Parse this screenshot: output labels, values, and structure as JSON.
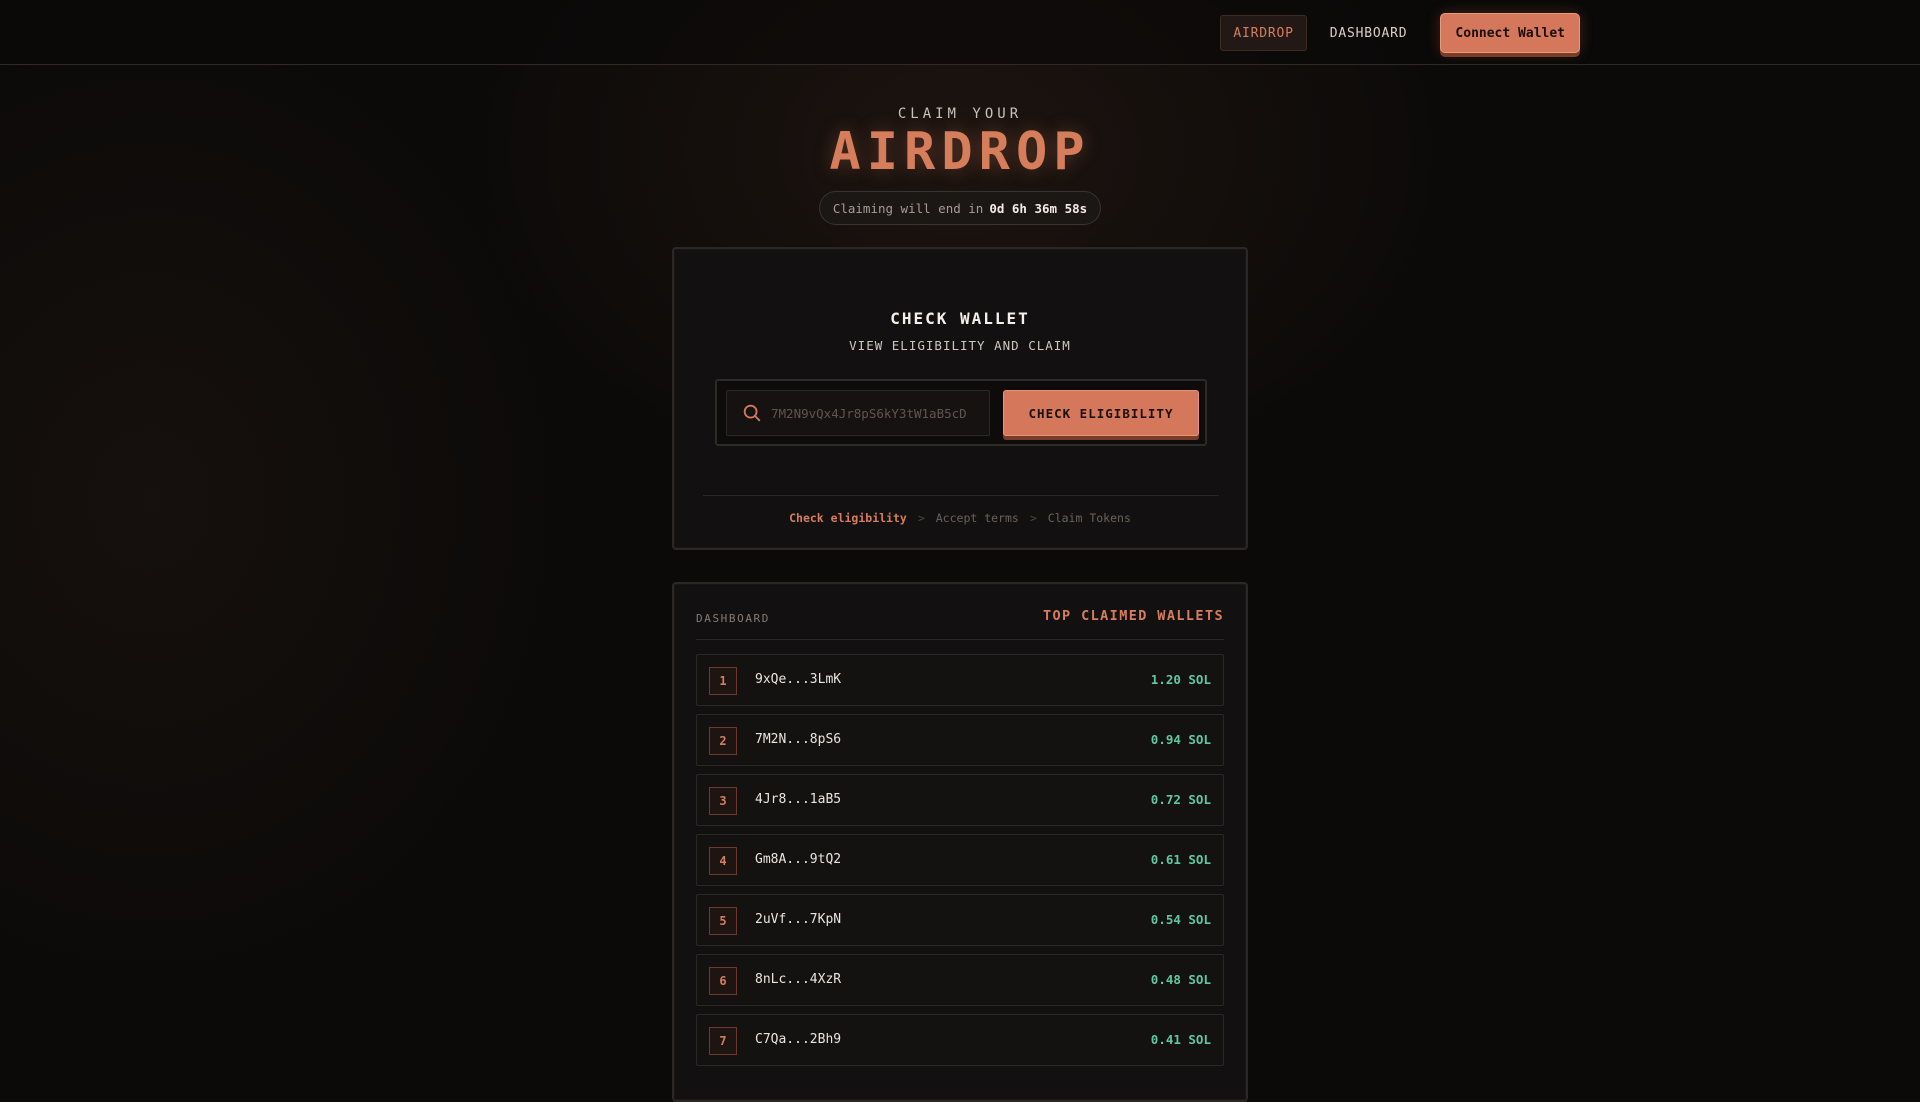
{
  "nav": {
    "items": [
      {
        "label": "AIRDROP",
        "active": true
      },
      {
        "label": "DASHBOARD",
        "active": false
      }
    ],
    "connect_label": "Connect Wallet"
  },
  "hero": {
    "kicker": "CLAIM YOUR",
    "title": "AIRDROP",
    "countdown_prefix": "Claiming will end in",
    "countdown_value": "0d 6h 36m 58s"
  },
  "check": {
    "title": "CHECK WALLET",
    "subtitle": "VIEW ELIGIBILITY AND CLAIM",
    "search_placeholder": "7M2N9vQx4Jr8pS6kY3tW1aB5cD",
    "button_label": "CHECK ELIGIBILITY",
    "steps": [
      {
        "label": "Check eligibility",
        "current": true
      },
      {
        "label": "Accept terms",
        "current": false
      },
      {
        "label": "Claim Tokens",
        "current": false
      }
    ],
    "step_separator": ">"
  },
  "dashboard": {
    "label": "DASHBOARD",
    "title": "TOP CLAIMED WALLETS",
    "rows": [
      {
        "rank": "1",
        "wallet": "9xQe...3LmK",
        "amount": "1.20 SOL"
      },
      {
        "rank": "2",
        "wallet": "7M2N...8pS6",
        "amount": "0.94 SOL"
      },
      {
        "rank": "3",
        "wallet": "4Jr8...1aB5",
        "amount": "0.72 SOL"
      },
      {
        "rank": "4",
        "wallet": "Gm8A...9tQ2",
        "amount": "0.61 SOL"
      },
      {
        "rank": "5",
        "wallet": "2uVf...7KpN",
        "amount": "0.54 SOL"
      },
      {
        "rank": "6",
        "wallet": "8nLc...4XzR",
        "amount": "0.48 SOL"
      },
      {
        "rank": "7",
        "wallet": "C7Qa...2Bh9",
        "amount": "0.41 SOL"
      }
    ]
  },
  "colors": {
    "accent": "#d4775a",
    "positive": "#5ec9a0",
    "background": "#0c0a09"
  }
}
